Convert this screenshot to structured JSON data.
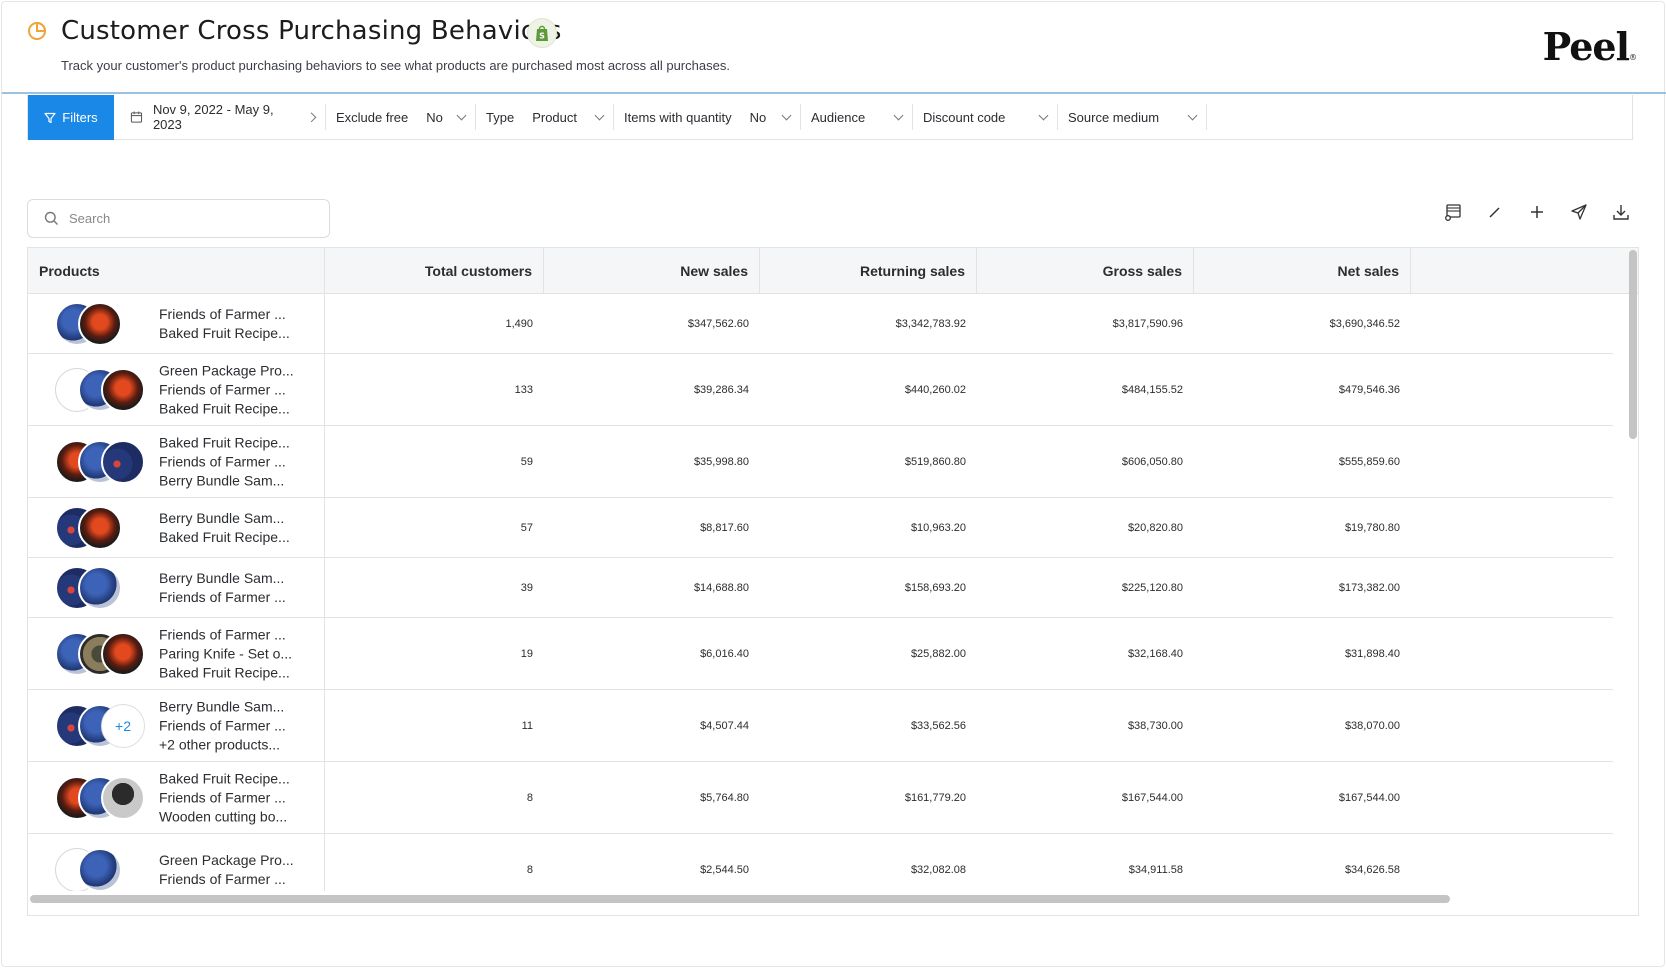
{
  "header": {
    "title": "Customer Cross Purchasing Behaviors",
    "subtitle": "Track your customer's product purchasing behaviors to see what products are purchased most across all purchases.",
    "brand": "Peel",
    "brand_mark": "®",
    "title_icon": "pie-chart-icon",
    "badge_icon": "shopify-bag-icon",
    "accent_color": "#1a88e6"
  },
  "filterbar": {
    "filters_label": "Filters",
    "date_range": "Nov 9, 2022 - May 9, 2023",
    "exclude_free": {
      "label": "Exclude free",
      "value": "No"
    },
    "type": {
      "label": "Type",
      "value": "Product"
    },
    "items_with_quantity": {
      "label": "Items with quantity",
      "value": "No"
    },
    "audience": {
      "label": "Audience"
    },
    "discount_code": {
      "label": "Discount code"
    },
    "source_medium": {
      "label": "Source medium"
    }
  },
  "search": {
    "placeholder": "Search"
  },
  "toolbar": [
    "cart-icon",
    "edit-icon",
    "plus-icon",
    "send-icon",
    "download-icon"
  ],
  "table": {
    "columns": [
      "Products",
      "Total customers",
      "New sales",
      "Returning sales",
      "Gross sales",
      "Net sales"
    ],
    "rows": [
      {
        "products": [
          "Friends of Farmer ...",
          "Baked Fruit Recipe..."
        ],
        "thumbs": [
          "blue",
          "red"
        ],
        "total_customers": "1,490",
        "new_sales": "$347,562.60",
        "returning_sales": "$3,342,783.92",
        "gross_sales": "$3,817,590.96",
        "net_sales": "$3,690,346.52"
      },
      {
        "products": [
          "Green Package Pro...",
          "Friends of Farmer ...",
          "Baked Fruit Recipe..."
        ],
        "thumbs": [
          "empty",
          "blue",
          "red"
        ],
        "total_customers": "133",
        "new_sales": "$39,286.34",
        "returning_sales": "$440,260.02",
        "gross_sales": "$484,155.52",
        "net_sales": "$479,546.36"
      },
      {
        "products": [
          "Baked Fruit Recipe...",
          "Friends of Farmer ...",
          "Berry Bundle Sam..."
        ],
        "thumbs": [
          "red",
          "blue",
          "berry"
        ],
        "total_customers": "59",
        "new_sales": "$35,998.80",
        "returning_sales": "$519,860.80",
        "gross_sales": "$606,050.80",
        "net_sales": "$555,859.60"
      },
      {
        "products": [
          "Berry Bundle Sam...",
          "Baked Fruit Recipe..."
        ],
        "thumbs": [
          "berry",
          "red"
        ],
        "total_customers": "57",
        "new_sales": "$8,817.60",
        "returning_sales": "$10,963.20",
        "gross_sales": "$20,820.80",
        "net_sales": "$19,780.80"
      },
      {
        "products": [
          "Berry Bundle Sam...",
          "Friends of Farmer ..."
        ],
        "thumbs": [
          "berry",
          "blue"
        ],
        "total_customers": "39",
        "new_sales": "$14,688.80",
        "returning_sales": "$158,693.20",
        "gross_sales": "$225,120.80",
        "net_sales": "$173,382.00"
      },
      {
        "products": [
          "Friends of Farmer ...",
          "Paring Knife - Set o...",
          "Baked Fruit Recipe..."
        ],
        "thumbs": [
          "blue",
          "knife",
          "red"
        ],
        "total_customers": "19",
        "new_sales": "$6,016.40",
        "returning_sales": "$25,882.00",
        "gross_sales": "$32,168.40",
        "net_sales": "$31,898.40"
      },
      {
        "products": [
          "Berry Bundle Sam...",
          "Friends of Farmer ...",
          "+2 other products..."
        ],
        "thumbs": [
          "berry",
          "blue",
          "more"
        ],
        "more_label": "+2",
        "total_customers": "11",
        "new_sales": "$4,507.44",
        "returning_sales": "$33,562.56",
        "gross_sales": "$38,730.00",
        "net_sales": "$38,070.00"
      },
      {
        "products": [
          "Baked Fruit Recipe...",
          "Friends of Farmer ...",
          "Wooden cutting bo..."
        ],
        "thumbs": [
          "red",
          "blue",
          "wood"
        ],
        "total_customers": "8",
        "new_sales": "$5,764.80",
        "returning_sales": "$161,779.20",
        "gross_sales": "$167,544.00",
        "net_sales": "$167,544.00"
      },
      {
        "products": [
          "Green Package Pro...",
          "Friends of Farmer ..."
        ],
        "thumbs": [
          "empty",
          "blue"
        ],
        "total_customers": "8",
        "new_sales": "$2,544.50",
        "returning_sales": "$32,082.08",
        "gross_sales": "$34,911.58",
        "net_sales": "$34,626.58"
      }
    ]
  }
}
